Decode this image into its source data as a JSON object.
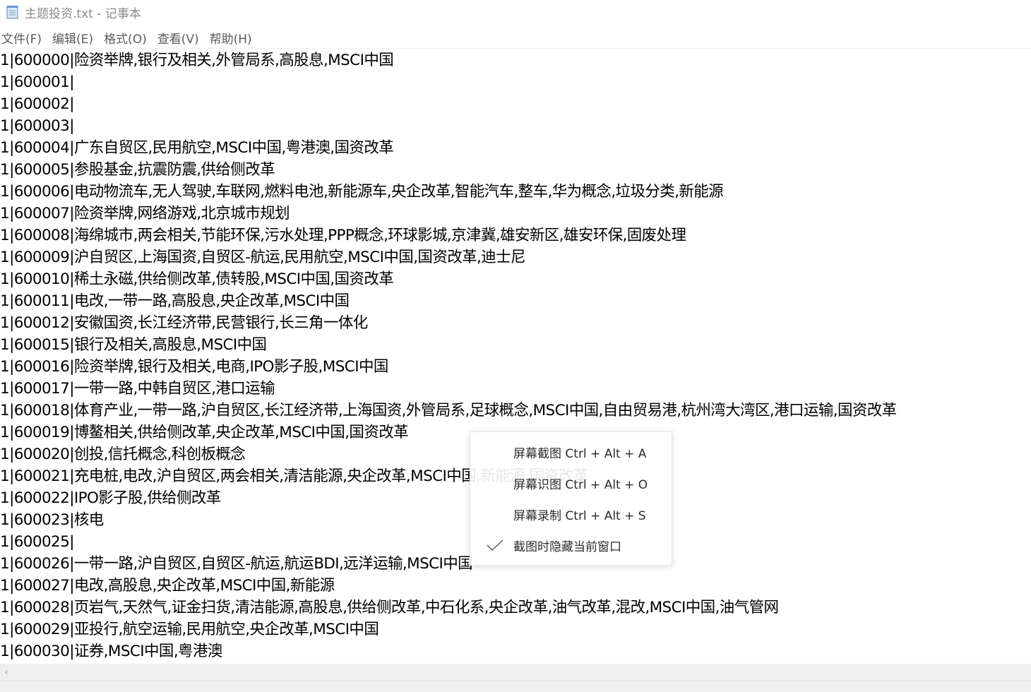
{
  "window": {
    "title": "主题投资.txt - 记事本"
  },
  "menu": [
    "文件(F)",
    "编辑(E)",
    "格式(O)",
    "查看(V)",
    "帮助(H)"
  ],
  "lines": [
    "1|600000|险资举牌,银行及相关,外管局系,高股息,MSCI中国",
    "1|600001|",
    "1|600002|",
    "1|600003|",
    "1|600004|广东自贸区,民用航空,MSCI中国,粤港澳,国资改革",
    "1|600005|参股基金,抗震防震,供给侧改革",
    "1|600006|电动物流车,无人驾驶,车联网,燃料电池,新能源车,央企改革,智能汽车,整车,华为概念,垃圾分类,新能源",
    "1|600007|险资举牌,网络游戏,北京城市规划",
    "1|600008|海绵城市,两会相关,节能环保,污水处理,PPP概念,环球影城,京津冀,雄安新区,雄安环保,固废处理",
    "1|600009|沪自贸区,上海国资,自贸区-航运,民用航空,MSCI中国,国资改革,迪士尼",
    "1|600010|稀土永磁,供给侧改革,债转股,MSCI中国,国资改革",
    "1|600011|电改,一带一路,高股息,央企改革,MSCI中国",
    "1|600012|安徽国资,长江经济带,民营银行,长三角一体化",
    "1|600015|银行及相关,高股息,MSCI中国",
    "1|600016|险资举牌,银行及相关,电商,IPO影子股,MSCI中国",
    "1|600017|一带一路,中韩自贸区,港口运输",
    "1|600018|体育产业,一带一路,沪自贸区,长江经济带,上海国资,外管局系,足球概念,MSCI中国,自由贸易港,杭州湾大湾区,港口运输,国资改革",
    "1|600019|博鳌相关,供给侧改革,央企改革,MSCI中国,国资改革",
    "1|600020|创投,信托概念,科创板概念",
    "1|600021|充电桩,电改,沪自贸区,两会相关,清洁能源,央企改革,MSCI中国,新能源,国资改革",
    "1|600022|IPO影子股,供给侧改革",
    "1|600023|核电",
    "1|600025|",
    "1|600026|一带一路,沪自贸区,自贸区-航运,航运BDI,远洋运输,MSCI中国",
    "1|600027|电改,高股息,央企改革,MSCI中国,新能源",
    "1|600028|页岩气,天然气,证金扫货,清洁能源,高股息,供给侧改革,中石化系,央企改革,油气改革,混改,MSCI中国,油气管网",
    "1|600029|亚投行,航空运输,民用航空,央企改革,MSCI中国",
    "1|600030|证券,MSCI中国,粤港澳"
  ],
  "context_menu": {
    "items": [
      {
        "label": "屏幕截图 Ctrl + Alt + A",
        "checked": false
      },
      {
        "label": "屏幕识图 Ctrl + Alt + O",
        "checked": false
      },
      {
        "label": "屏幕录制 Ctrl + Alt + S",
        "checked": false
      },
      {
        "label": "截图时隐藏当前窗口",
        "checked": true
      }
    ]
  },
  "icons": {
    "app": "notepad-icon",
    "check": "check-icon",
    "scroll_left": "chevron-left-icon"
  },
  "colors": {
    "text": "#000000",
    "title_text": "#8a8a8a",
    "menu_text": "#5a5a5a",
    "scrollbar": "#f0f0f0"
  }
}
